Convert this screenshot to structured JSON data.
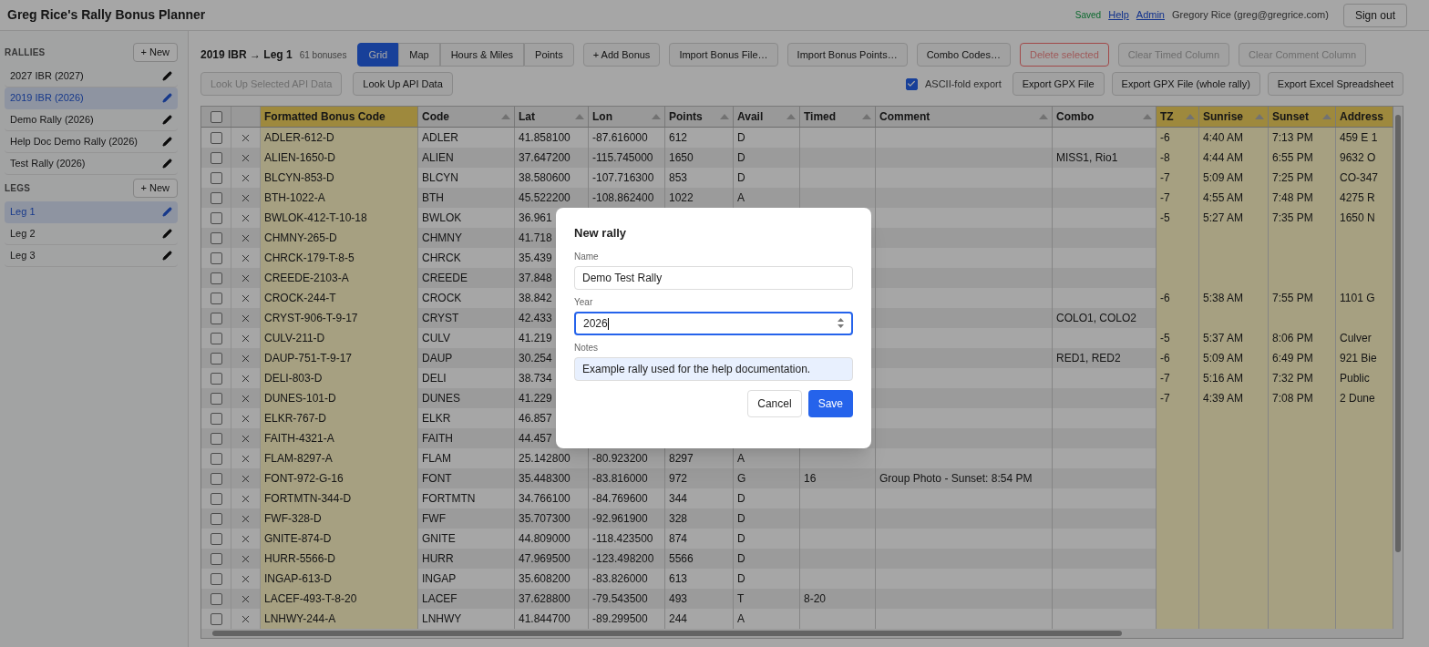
{
  "app": {
    "title": "Greg Rice's Rally Bonus Planner",
    "status": "Saved",
    "links": [
      "Help",
      "Admin"
    ],
    "user": "Gregory Rice (greg@gregrice.com)",
    "sign_out": "Sign out"
  },
  "sidebar": {
    "sections": [
      {
        "heading": "RALLIES",
        "new_button": "+ New",
        "items": [
          {
            "label": "2027 IBR (2027)",
            "selected": false
          },
          {
            "label": "2019 IBR (2026)",
            "selected": true
          },
          {
            "label": "Demo Rally (2026)",
            "selected": false
          },
          {
            "label": "Help Doc Demo Rally (2026)",
            "selected": false
          },
          {
            "label": "Test Rally (2026)",
            "selected": false
          }
        ]
      },
      {
        "heading": "LEGS",
        "new_button": "+ New",
        "items": [
          {
            "label": "Leg 1",
            "selected": true
          },
          {
            "label": "Leg 2",
            "selected": false
          },
          {
            "label": "Leg 3",
            "selected": false
          }
        ]
      }
    ]
  },
  "toolbar": {
    "title": "2019 IBR → Leg 1",
    "count": "61 bonuses",
    "view_tabs": [
      {
        "label": "Grid",
        "selected": true
      },
      {
        "label": "Map",
        "selected": false
      },
      {
        "label": "Hours & Miles",
        "selected": false
      },
      {
        "label": "Points",
        "selected": false
      }
    ],
    "buttons": [
      {
        "label": "+ Add Bonus",
        "kind": "normal",
        "disabled": false
      },
      {
        "label": "Import Bonus File…",
        "kind": "normal",
        "disabled": false
      },
      {
        "label": "Import Bonus Points…",
        "kind": "normal",
        "disabled": false
      },
      {
        "label": "Combo Codes…",
        "kind": "normal",
        "disabled": false
      },
      {
        "label": "Delete selected",
        "kind": "danger",
        "disabled": true
      },
      {
        "label": "Clear Timed Column",
        "kind": "normal",
        "disabled": true
      },
      {
        "label": "Clear Comment Column",
        "kind": "normal",
        "disabled": true
      }
    ],
    "lookup_buttons": [
      {
        "label": "Look Up Selected API Data",
        "disabled": true
      },
      {
        "label": "Look Up API Data",
        "disabled": false
      }
    ],
    "ascii_fold": {
      "label": "ASCII-fold export",
      "checked": true
    },
    "export_buttons": [
      "Export GPX File",
      "Export GPX File (whole rally)",
      "Export Excel Spreadsheet"
    ]
  },
  "table": {
    "select_all_checked": false,
    "columns": [
      {
        "label": "Formatted Bonus Code",
        "sortable": false,
        "highlight": true
      },
      {
        "label": "Code",
        "sortable": true,
        "highlight": false
      },
      {
        "label": "Lat",
        "sortable": true,
        "highlight": false
      },
      {
        "label": "Lon",
        "sortable": true,
        "highlight": false
      },
      {
        "label": "Points",
        "sortable": true,
        "highlight": false
      },
      {
        "label": "Avail",
        "sortable": true,
        "highlight": false
      },
      {
        "label": "Timed",
        "sortable": true,
        "highlight": false
      },
      {
        "label": "Comment",
        "sortable": true,
        "highlight": false
      },
      {
        "label": "Combo",
        "sortable": true,
        "highlight": false
      },
      {
        "label": "TZ",
        "sortable": true,
        "highlight": true
      },
      {
        "label": "Sunrise",
        "sortable": true,
        "highlight": true
      },
      {
        "label": "Sunset",
        "sortable": true,
        "highlight": true
      },
      {
        "label": "Address",
        "sortable": false,
        "highlight": true
      }
    ],
    "rows": [
      {
        "selected": false,
        "cells": [
          "ADLER-612-D",
          "ADLER",
          "41.858100",
          "-87.616000",
          "612",
          "D",
          null,
          null,
          null,
          "-6",
          "4:40 AM",
          "7:13 PM",
          "459 E 1"
        ]
      },
      {
        "selected": false,
        "cells": [
          "ALIEN-1650-D",
          "ALIEN",
          "37.647200",
          "-115.745000",
          "1650",
          "D",
          null,
          null,
          "MISS1, Rio1",
          "-8",
          "4:44 AM",
          "6:55 PM",
          "9632 O"
        ]
      },
      {
        "selected": false,
        "cells": [
          "BLCYN-853-D",
          "BLCYN",
          "38.580600",
          "-107.716300",
          "853",
          "D",
          null,
          null,
          null,
          "-7",
          "5:09 AM",
          "7:25 PM",
          "CO-347"
        ]
      },
      {
        "selected": false,
        "cells": [
          "BTH-1022-A",
          "BTH",
          "45.522200",
          "-108.862400",
          "1022",
          "A",
          null,
          null,
          null,
          "-7",
          "4:55 AM",
          "7:48 PM",
          "4275 R"
        ]
      },
      {
        "selected": false,
        "cells": [
          "BWLOK-412-T-10-18",
          "BWLOK",
          "36.961",
          null,
          null,
          null,
          null,
          null,
          null,
          "-5",
          "5:27 AM",
          "7:35 PM",
          "1650 N"
        ]
      },
      {
        "selected": false,
        "cells": [
          "CHMNY-265-D",
          "CHMNY",
          "41.718",
          null,
          null,
          null,
          null,
          null,
          null,
          null,
          null,
          null,
          null
        ]
      },
      {
        "selected": false,
        "cells": [
          "CHRCK-179-T-8-5",
          "CHRCK",
          "35.439",
          null,
          null,
          null,
          null,
          null,
          null,
          null,
          null,
          null,
          null
        ]
      },
      {
        "selected": false,
        "cells": [
          "CREEDE-2103-A",
          "CREEDE",
          "37.848",
          null,
          null,
          null,
          null,
          null,
          null,
          null,
          null,
          null,
          null
        ]
      },
      {
        "selected": false,
        "cells": [
          "CROCK-244-T",
          "CROCK",
          "38.842",
          null,
          null,
          null,
          null,
          null,
          null,
          "-6",
          "5:38 AM",
          "7:55 PM",
          "1101 G"
        ]
      },
      {
        "selected": false,
        "cells": [
          "CRYST-906-T-9-17",
          "CRYST",
          "42.433",
          null,
          null,
          null,
          null,
          null,
          "COLO1, COLO2",
          null,
          null,
          null,
          null
        ]
      },
      {
        "selected": false,
        "cells": [
          "CULV-211-D",
          "CULV",
          "41.219",
          null,
          null,
          null,
          null,
          null,
          null,
          "-5",
          "5:37 AM",
          "8:06 PM",
          "Culver"
        ]
      },
      {
        "selected": false,
        "cells": [
          "DAUP-751-T-9-17",
          "DAUP",
          "30.254",
          null,
          null,
          null,
          null,
          null,
          "RED1, RED2",
          "-6",
          "5:09 AM",
          "6:49 PM",
          "921 Bie"
        ]
      },
      {
        "selected": false,
        "cells": [
          "DELI-803-D",
          "DELI",
          "38.734",
          null,
          null,
          null,
          null,
          null,
          null,
          "-7",
          "5:16 AM",
          "7:32 PM",
          "Public"
        ]
      },
      {
        "selected": false,
        "cells": [
          "DUNES-101-D",
          "DUNES",
          "41.229",
          null,
          null,
          null,
          null,
          null,
          null,
          "-7",
          "4:39 AM",
          "7:08 PM",
          "2 Dune"
        ]
      },
      {
        "selected": false,
        "cells": [
          "ELKR-767-D",
          "ELKR",
          "46.857",
          null,
          null,
          null,
          null,
          null,
          null,
          null,
          null,
          null,
          null
        ]
      },
      {
        "selected": false,
        "cells": [
          "FAITH-4321-A",
          "FAITH",
          "44.457",
          null,
          null,
          null,
          null,
          null,
          null,
          null,
          null,
          null,
          null
        ]
      },
      {
        "selected": false,
        "cells": [
          "FLAM-8297-A",
          "FLAM",
          "25.142800",
          "-80.923200",
          "8297",
          "A",
          null,
          null,
          null,
          null,
          null,
          null,
          null
        ]
      },
      {
        "selected": false,
        "cells": [
          "FONT-972-G-16",
          "FONT",
          "35.448300",
          "-83.816000",
          "972",
          "G",
          "16",
          "Group Photo - Sunset: 8:54 PM",
          null,
          null,
          null,
          null,
          null
        ]
      },
      {
        "selected": false,
        "cells": [
          "FORTMTN-344-D",
          "FORTMTN",
          "34.766100",
          "-84.769600",
          "344",
          "D",
          null,
          null,
          null,
          null,
          null,
          null,
          null
        ]
      },
      {
        "selected": false,
        "cells": [
          "FWF-328-D",
          "FWF",
          "35.707300",
          "-92.961900",
          "328",
          "D",
          null,
          null,
          null,
          null,
          null,
          null,
          null
        ]
      },
      {
        "selected": false,
        "cells": [
          "GNITE-874-D",
          "GNITE",
          "44.809000",
          "-118.423500",
          "874",
          "D",
          null,
          null,
          null,
          null,
          null,
          null,
          null
        ]
      },
      {
        "selected": false,
        "cells": [
          "HURR-5566-D",
          "HURR",
          "47.969500",
          "-123.498200",
          "5566",
          "D",
          null,
          null,
          null,
          null,
          null,
          null,
          null
        ]
      },
      {
        "selected": false,
        "cells": [
          "INGAP-613-D",
          "INGAP",
          "35.608200",
          "-83.826000",
          "613",
          "D",
          null,
          null,
          null,
          null,
          null,
          null,
          null
        ]
      },
      {
        "selected": false,
        "cells": [
          "LACEF-493-T-8-20",
          "LACEF",
          "37.628800",
          "-79.543500",
          "493",
          "T",
          "8-20",
          null,
          null,
          null,
          null,
          null,
          null
        ]
      },
      {
        "selected": false,
        "cells": [
          "LNHWY-244-A",
          "LNHWY",
          "41.844700",
          "-89.299500",
          "244",
          "A",
          null,
          null,
          null,
          null,
          null,
          null,
          null
        ]
      }
    ]
  },
  "dialog": {
    "title": "New rally",
    "fields": [
      {
        "label": "Name",
        "value": "Demo Test Rally",
        "focused": false,
        "kind": "text"
      },
      {
        "label": "Year",
        "value": "2026",
        "focused": true,
        "kind": "number"
      },
      {
        "label": "Notes",
        "value": "Example rally used for the help documentation.",
        "focused": false,
        "kind": "notes"
      }
    ],
    "cancel": "Cancel",
    "save": "Save"
  }
}
